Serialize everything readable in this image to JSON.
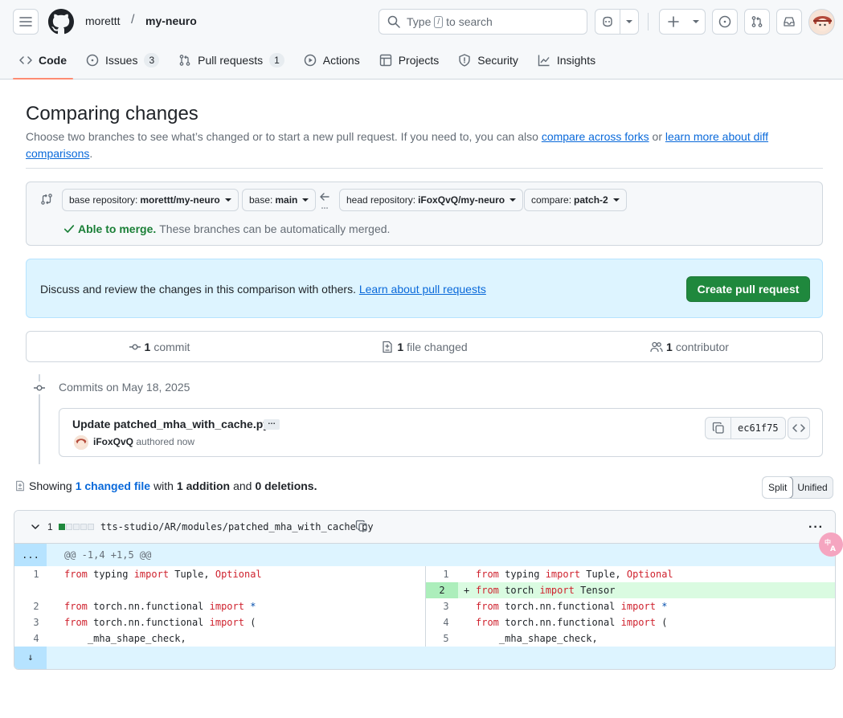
{
  "header": {
    "owner": "morettt",
    "separator": "/",
    "repo": "my-neuro",
    "search": {
      "prefix": "Type",
      "key": "/",
      "suffix": "to search"
    }
  },
  "tabs": [
    {
      "label": "Code",
      "icon": "code-icon",
      "count": null,
      "active": true
    },
    {
      "label": "Issues",
      "icon": "issue-opened-icon",
      "count": "3"
    },
    {
      "label": "Pull requests",
      "icon": "git-pull-request-icon",
      "count": "1"
    },
    {
      "label": "Actions",
      "icon": "play-icon"
    },
    {
      "label": "Projects",
      "icon": "table-icon"
    },
    {
      "label": "Security",
      "icon": "shield-icon"
    },
    {
      "label": "Insights",
      "icon": "graph-icon"
    }
  ],
  "compare": {
    "title": "Comparing changes",
    "description_prefix": "Choose two branches to see what’s changed or to start a new pull request. If you need to, you can also ",
    "link_forks": "compare across forks",
    "description_middle": " or ",
    "link_learn": "learn more about diff comparisons",
    "description_suffix": "."
  },
  "range": {
    "base_repo_label": "base repository:",
    "base_repo_value": "morettt/my-neuro",
    "base_label": "base:",
    "base_value": "main",
    "head_repo_label": "head repository:",
    "head_repo_value": "iFoxQvQ/my-neuro",
    "compare_label": "compare:",
    "compare_value": "patch-2",
    "merge_status": "Able to merge.",
    "merge_detail": "These branches can be automatically merged."
  },
  "flash": {
    "text": "Discuss and review the changes in this comparison with others.",
    "link": "Learn about pull requests",
    "button": "Create pull request"
  },
  "stats": {
    "commits_num": "1",
    "commits_label": "commit",
    "files_num": "1",
    "files_label": "file changed",
    "contributors_num": "1",
    "contributors_label": "contributor"
  },
  "commits": {
    "date_heading": "Commits on May 18, 2025",
    "title": "Update patched_mha_with_cache.py",
    "ellipsis": "…",
    "author": "iFoxQvQ",
    "meta": "authored now",
    "sha": "ec61f75"
  },
  "summary": {
    "showing": "Showing",
    "changed": "1 changed file",
    "with": "with",
    "additions": "1 addition",
    "and": "and",
    "deletions": "0 deletions."
  },
  "view_toggle": {
    "split": "Split",
    "unified": "Unified",
    "selected": "Split"
  },
  "file": {
    "changes": "1",
    "path": "tts-studio/AR/modules/patched_mha_with_cache.py",
    "hunk_expander": "...",
    "hunk_header": "@@ -1,4 +1,5 @@",
    "left": [
      {
        "n": "1",
        "code": "from typing import Tuple, Optional"
      },
      {
        "n": "",
        "code": ""
      },
      {
        "n": "2",
        "code": "from torch.nn.functional import *"
      },
      {
        "n": "3",
        "code": "from torch.nn.functional import ("
      },
      {
        "n": "4",
        "code": "    _mha_shape_check,"
      }
    ],
    "right": [
      {
        "n": "1",
        "code": "from typing import Tuple, Optional",
        "added": false
      },
      {
        "n": "2",
        "code": "from torch import Tensor",
        "added": true
      },
      {
        "n": "3",
        "code": "from torch.nn.functional import *",
        "added": false
      },
      {
        "n": "4",
        "code": "from torch.nn.functional import (",
        "added": false
      },
      {
        "n": "5",
        "code": "    _mha_shape_check,",
        "added": false
      }
    ],
    "expand_down": "↓"
  },
  "colors": {
    "accent_green": "#1f883d",
    "tab_underline": "#fd8c73",
    "link": "#0969da",
    "add_bg": "#dafbe1",
    "hunk_bg": "#ddf4ff"
  }
}
